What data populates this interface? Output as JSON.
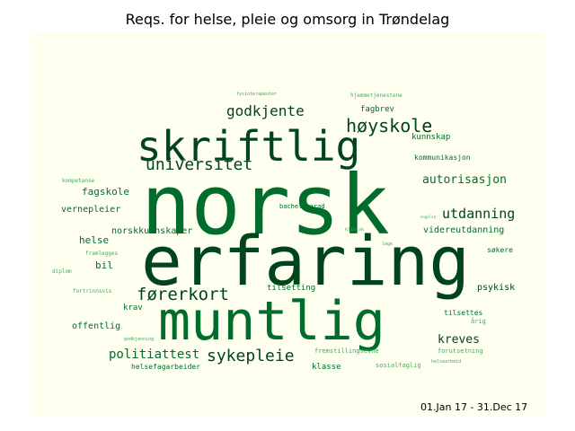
{
  "title": "Reqs. for helse, pleie og omsorg in Trøndelag",
  "date_range": "01.Jan 17 - 31.Dec 17",
  "colors": {
    "panel_background": "#fffff0",
    "word_dark": "#00441b",
    "word_mid": "#006d2c",
    "word_light": "#41ab5d"
  },
  "chart_data": {
    "type": "wordcloud",
    "title": "Reqs. for helse, pleie og omsorg in Trøndelag",
    "words": [
      {
        "text": "norsk",
        "weight": 100
      },
      {
        "text": "erfaring",
        "weight": 82
      },
      {
        "text": "muntlig",
        "weight": 66
      },
      {
        "text": "skriftlig",
        "weight": 50
      },
      {
        "text": "universitet",
        "weight": 24
      },
      {
        "text": "høyskole",
        "weight": 22
      },
      {
        "text": "førerkort",
        "weight": 22
      },
      {
        "text": "sykepleie",
        "weight": 20
      },
      {
        "text": "godkjente",
        "weight": 18
      },
      {
        "text": "utdanning",
        "weight": 17
      },
      {
        "text": "politiattest",
        "weight": 17
      },
      {
        "text": "autorisasjon",
        "weight": 14
      },
      {
        "text": "kreves",
        "weight": 13
      },
      {
        "text": "fagskole",
        "weight": 11
      },
      {
        "text": "helse",
        "weight": 11
      },
      {
        "text": "bil",
        "weight": 11
      },
      {
        "text": "vernepleier",
        "weight": 10
      },
      {
        "text": "norskkunnskaper",
        "weight": 10
      },
      {
        "text": "videreutdanning",
        "weight": 10
      },
      {
        "text": "psykisk",
        "weight": 10
      },
      {
        "text": "offentlig",
        "weight": 10
      },
      {
        "text": "kunnskap",
        "weight": 9
      },
      {
        "text": "fagbrev",
        "weight": 9
      },
      {
        "text": "tilsetting",
        "weight": 9
      },
      {
        "text": "krav",
        "weight": 9
      },
      {
        "text": "klasse",
        "weight": 9
      },
      {
        "text": "tilsettes",
        "weight": 8
      },
      {
        "text": "kommunikasjon",
        "weight": 8
      },
      {
        "text": "søkere",
        "weight": 8
      },
      {
        "text": "helsefagarbeider",
        "weight": 8
      },
      {
        "text": "fremstillingsevne",
        "weight": 7
      },
      {
        "text": "sosialfaglig",
        "weight": 7
      },
      {
        "text": "forutsetning",
        "weight": 7
      },
      {
        "text": "årig",
        "weight": 7
      },
      {
        "text": "bachelorgrad",
        "weight": 7
      },
      {
        "text": "hjemmetjenestene",
        "weight": 6
      },
      {
        "text": "kompetanse",
        "weight": 6
      },
      {
        "text": "fortrinnsvis",
        "weight": 6
      },
      {
        "text": "framlegges",
        "weight": 6
      },
      {
        "text": "diplom",
        "weight": 6
      },
      {
        "text": "engelsk",
        "weight": 5
      },
      {
        "text": "klinisk",
        "weight": 5
      },
      {
        "text": "lege",
        "weight": 5
      },
      {
        "text": "godkjenning",
        "weight": 5
      },
      {
        "text": "fysioterapeuter",
        "weight": 5
      },
      {
        "text": "helsearbeid",
        "weight": 5
      }
    ]
  }
}
